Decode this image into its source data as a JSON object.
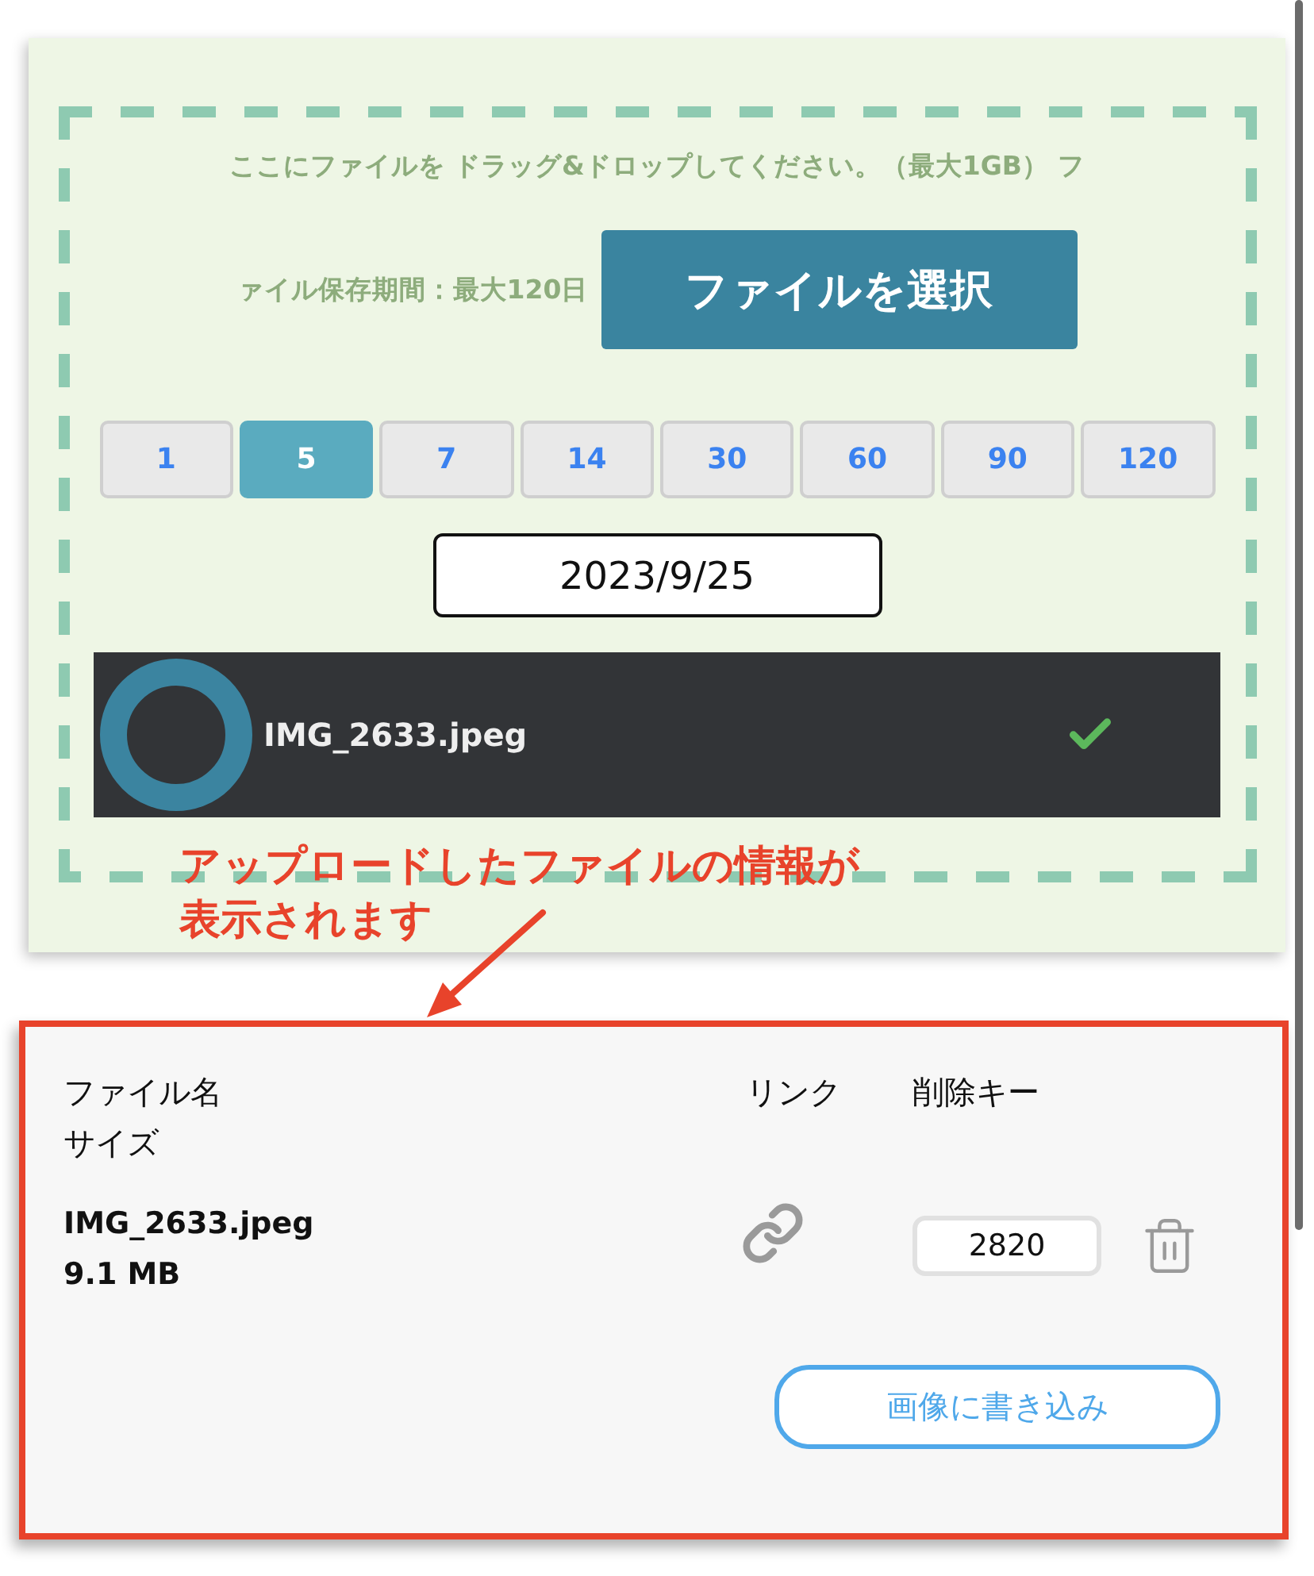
{
  "upload": {
    "instructions": [
      "ここにファイルを ドラッグ&ドロップしてください。（最大1GB） フ",
      "ァイル保存期間：最大120日"
    ],
    "select_button": "ファイルを選択",
    "retention_days": [
      {
        "label": "1",
        "selected": false
      },
      {
        "label": "5",
        "selected": true
      },
      {
        "label": "7",
        "selected": false
      },
      {
        "label": "14",
        "selected": false
      },
      {
        "label": "30",
        "selected": false
      },
      {
        "label": "60",
        "selected": false
      },
      {
        "label": "90",
        "selected": false
      },
      {
        "label": "120",
        "selected": false
      }
    ],
    "expiry_date": "2023/9/25",
    "files": [
      {
        "name": "IMG_2633.jpeg",
        "done": true
      }
    ]
  },
  "annotation": {
    "text": "アップロードしたファイルの情報が表示されます"
  },
  "result": {
    "headers": {
      "name": "ファイル名",
      "size": "サイズ",
      "link": "リンク",
      "delete_key": "削除キー"
    },
    "rows": [
      {
        "name": "IMG_2633.jpeg",
        "size": "9.1 MB",
        "delete_key": "2820"
      }
    ],
    "write_button": "画像に書き込み"
  }
}
